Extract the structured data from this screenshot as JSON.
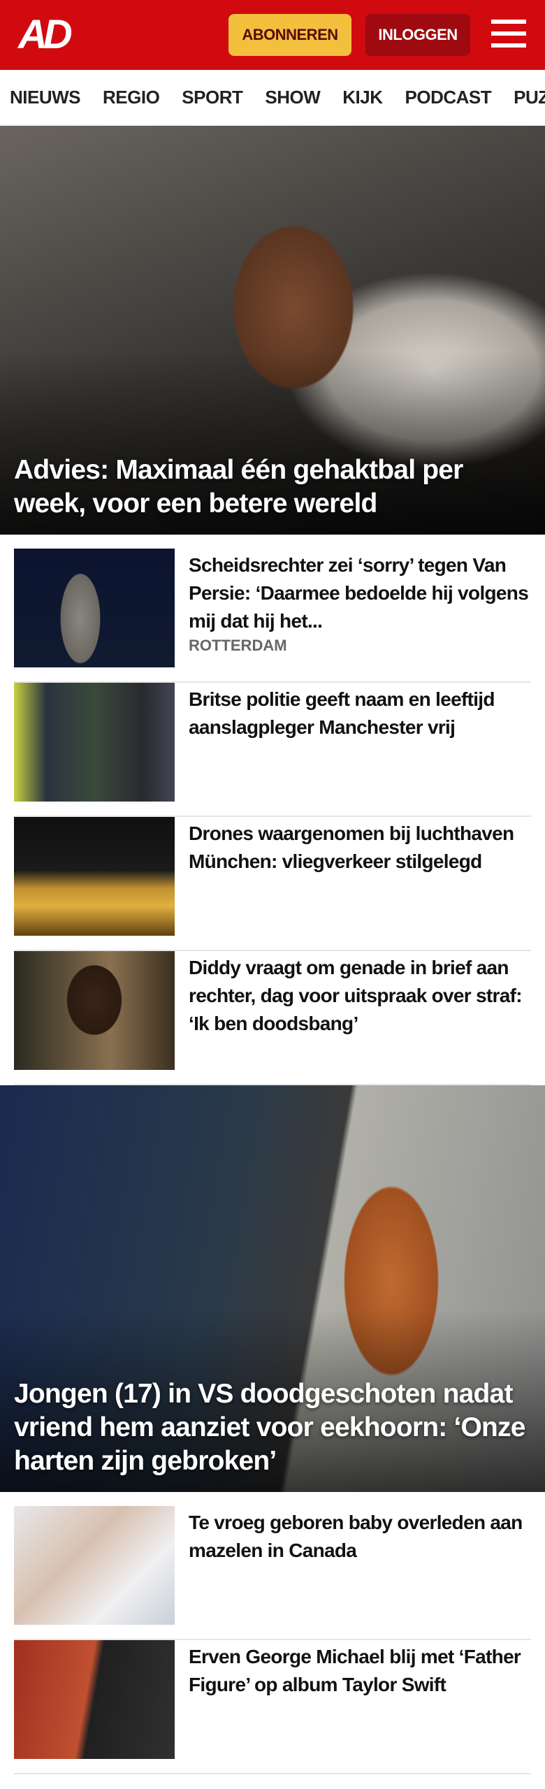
{
  "header": {
    "logo": "AD",
    "subscribe": "ABONNEREN",
    "login": "INLOGGEN"
  },
  "nav": [
    "NIEUWS",
    "REGIO",
    "SPORT",
    "SHOW",
    "KIJK",
    "PODCAST",
    "PUZZ"
  ],
  "hero1": {
    "title": "Advies: Maximaal één gehaktbal per week, voor een betere wereld"
  },
  "items1": [
    {
      "title": "Scheidsrechter zei ‘sorry’ tegen Van Persie: ‘Daarmee bedoelde hij volgens mij dat hij het...",
      "tag": "ROTTERDAM"
    },
    {
      "title": "Britse politie geeft naam en leeftijd aanslagpleger Manchester vrij"
    },
    {
      "title": "Drones waargenomen bij luchthaven München: vliegver­keer stilgelegd"
    },
    {
      "title": "Diddy vraagt om genade in brief aan rechter, dag voor uitspraak over straf: ‘Ik ben doodsbang’"
    }
  ],
  "hero2": {
    "title": "Jongen (17) in VS doodgeschoten nadat vriend hem aanziet voor eekhoorn: ‘Onze harten zijn gebroken’"
  },
  "items2": [
    {
      "title": "Te vroeg geboren baby overleden aan mazelen in Canada"
    },
    {
      "title": "Erven George Michael blij met ‘Father Figure’ op album Taylor Swift"
    }
  ]
}
